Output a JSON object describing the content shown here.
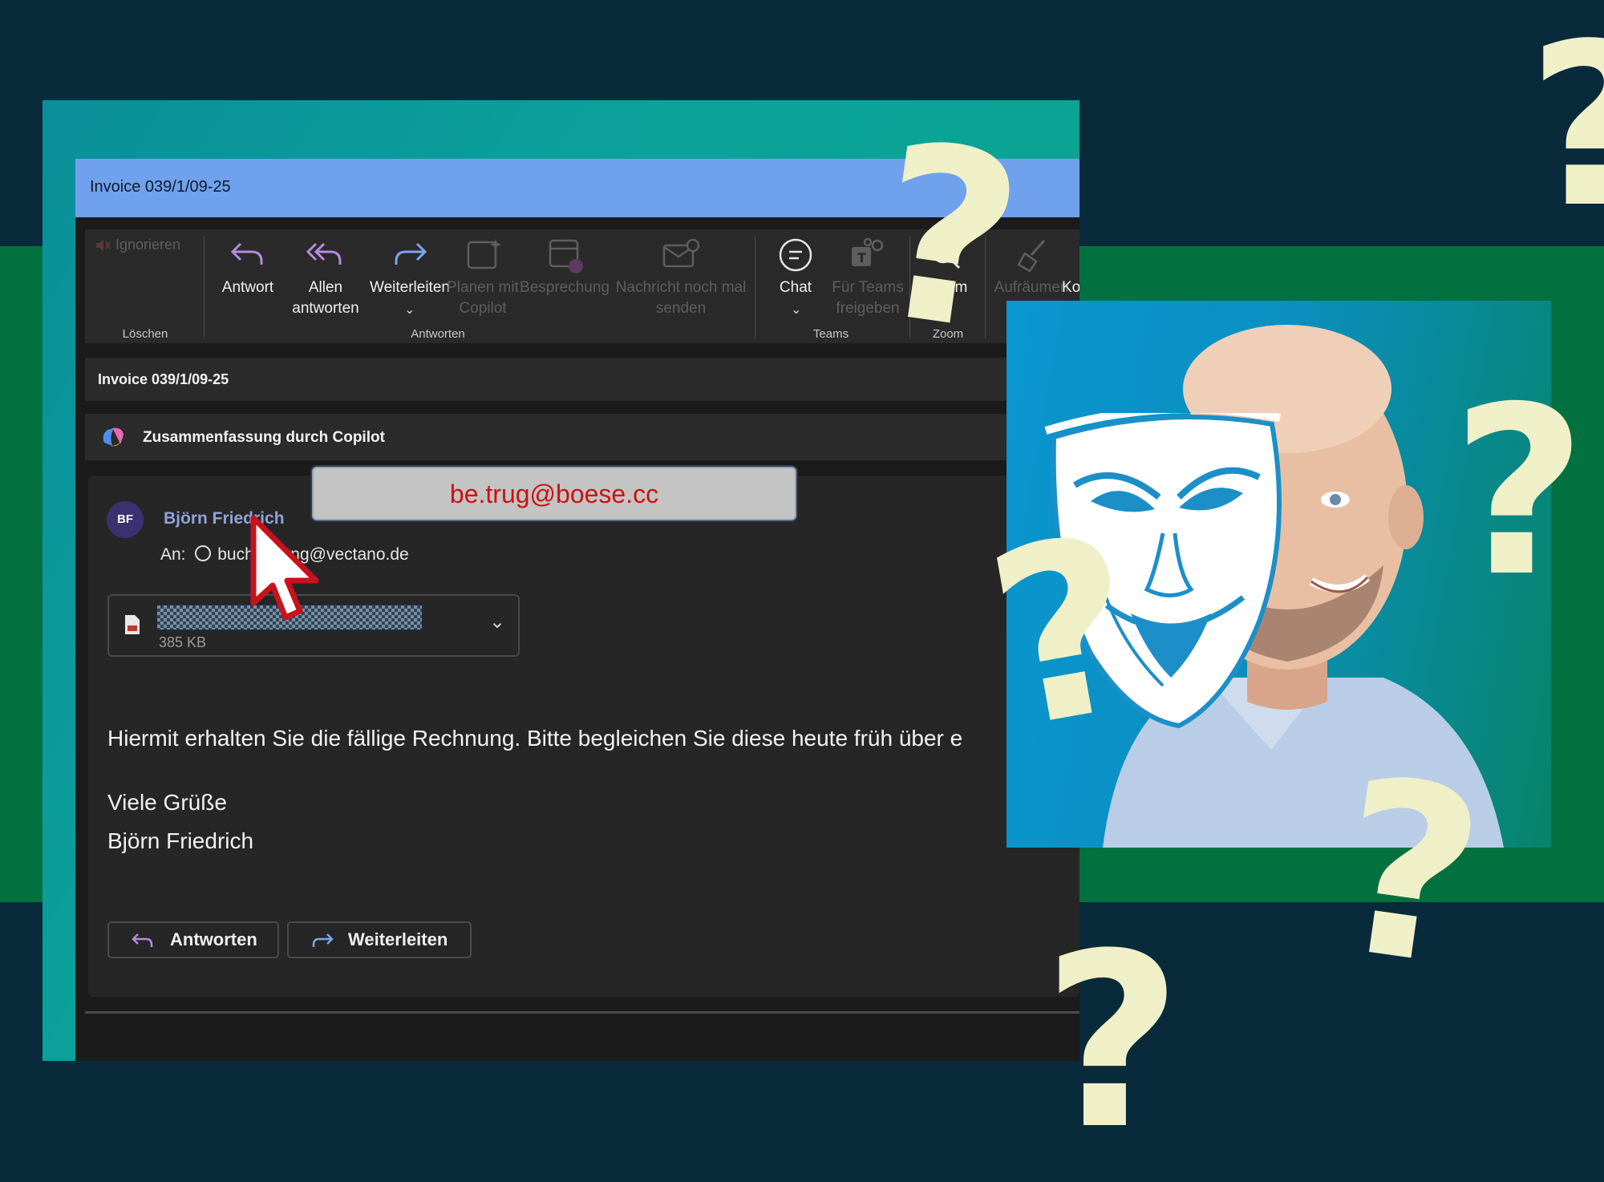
{
  "window": {
    "title": "Invoice 039/1/09-25"
  },
  "ribbon": {
    "ignore_label": "Ignorieren",
    "group_delete": "Löschen",
    "reply_label": "Antwort",
    "reply_all_line1": "Allen",
    "reply_all_line2": "antworten",
    "forward_label": "Weiterleiten",
    "plan_copilot_line1": "Planen mit",
    "plan_copilot_line2": "Copilot",
    "meeting_label": "Besprechung",
    "resend_line1": "Nachricht noch mal",
    "resend_line2": "senden",
    "group_reply": "Antworten",
    "chat_label": "Chat",
    "share_teams_line1": "Für Teams",
    "share_teams_line2": "freigeben",
    "group_teams": "Teams",
    "zoom_label": "Zoom",
    "group_zoom": "Zoom",
    "cleanup_label": "Aufräumen",
    "cut_label": "Ko"
  },
  "subject": "Invoice 039/1/09-25",
  "copilot_summary": "Zusammenfassung durch Copilot",
  "message": {
    "avatar_initials": "BF",
    "sender_name": "Björn Friedrich",
    "to_prefix": "An:",
    "to_address": "buchhaltung@vectano.de",
    "attachment_size": "385 KB",
    "body": "Hiermit erhalten Sie die fällige Rechnung. Bitte begleichen Sie diese heute früh über e",
    "greeting": "Viele Grüße",
    "signature": "Björn Friedrich"
  },
  "actions": {
    "reply": "Antworten",
    "forward": "Weiterleiten"
  },
  "tooltip": {
    "real_sender": "be.trug@boese.cc"
  },
  "colors": {
    "navy": "#082a3b",
    "green": "#03703f",
    "titlebar": "#6fa1ec",
    "warning_red": "#cc1111",
    "question_mark": "#eff0c8"
  },
  "icons": [
    "mask-icon",
    "cursor-arrow-icon",
    "question-mark-icon",
    "copilot-icon",
    "pdf-file-icon"
  ]
}
